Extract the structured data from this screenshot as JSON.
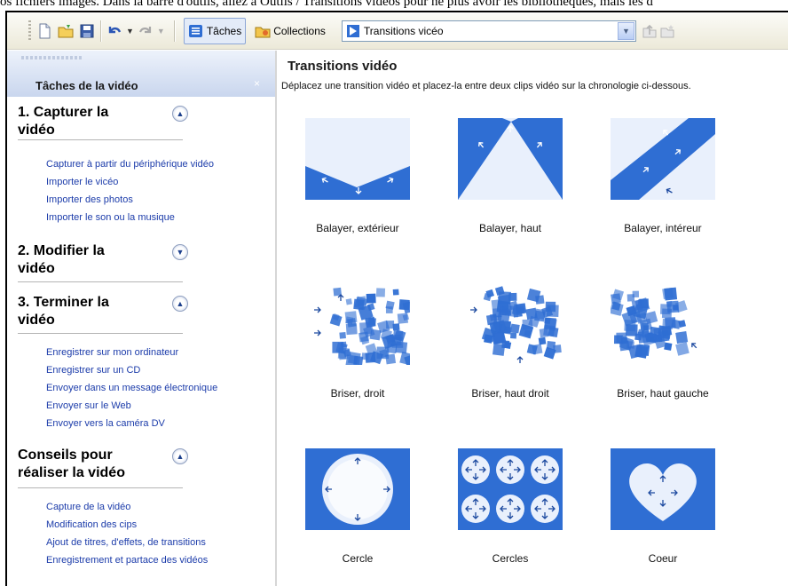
{
  "top_text": "os fichiers images. Dans la barre d'outils, allez à Outils / Transitions vidéos pour ne plus avoir les bibliothèques, mais les d",
  "toolbar": {
    "tasks_label": "Tâches",
    "collections_label": "Collections",
    "combo_value": "Transitions vicéo",
    "icons": [
      "new-icon",
      "open-icon",
      "save-icon",
      "undo-icon",
      "redo-icon",
      "tasks-icon",
      "collections-icon",
      "up-folder-icon",
      "new-folder-icon"
    ]
  },
  "task_pane": {
    "title": "Tâches de la vidéo",
    "close": "×",
    "sections": [
      {
        "title": "1. Capturer la\nvidéo",
        "state": "expanded",
        "links": [
          "Capturer à partir du périphérique vidéo",
          "Importer le vicéo",
          "Importer des photos",
          "Importer le son ou la musique"
        ]
      },
      {
        "title": "2. Modifier la\nvidéo",
        "state": "collapsed",
        "links": []
      },
      {
        "title": "3. Terminer la\nvidéo",
        "state": "expanded",
        "links": [
          "Enregistrer sur mon ordinateur",
          "Enregistrer sur un CD",
          "Envoyer dans un message électronique",
          "Envoyer sur le Web",
          "Envoyer vers la caméra DV"
        ]
      },
      {
        "title": "Conseils pour\nréaliser la vidéo",
        "state": "expanded",
        "links": [
          "Capture de la vidéo",
          "Modification des cips",
          "Ajout de titres, d'effets, de transitions",
          "Enregistrement et partace des vidéos"
        ]
      }
    ]
  },
  "content": {
    "title": "Transitions vidéo",
    "description": "Déplacez une transition vidéo et placez-la entre deux clips vidéo sur la chronologie ci-dessous.",
    "transitions": [
      {
        "label": "Balayer, extérieur",
        "icon": "sweep-out-icon"
      },
      {
        "label": "Balayer, haut",
        "icon": "sweep-up-icon"
      },
      {
        "label": "Balayer, intéreur",
        "icon": "sweep-in-icon"
      },
      {
        "label": "Briser, droit",
        "icon": "shatter-right-icon"
      },
      {
        "label": "Briser, haut droit",
        "icon": "shatter-up-right-icon"
      },
      {
        "label": "Briser, haut gauche",
        "icon": "shatter-up-left-icon"
      },
      {
        "label": "Cercle",
        "icon": "circle-icon"
      },
      {
        "label": "Cercles",
        "icon": "circles-icon"
      },
      {
        "label": "Coeur",
        "icon": "heart-icon"
      }
    ]
  },
  "colors": {
    "accent_blue": "#2f6ed3",
    "link_blue": "#1c3caa",
    "toolbar_bg": "#ece9d8"
  }
}
